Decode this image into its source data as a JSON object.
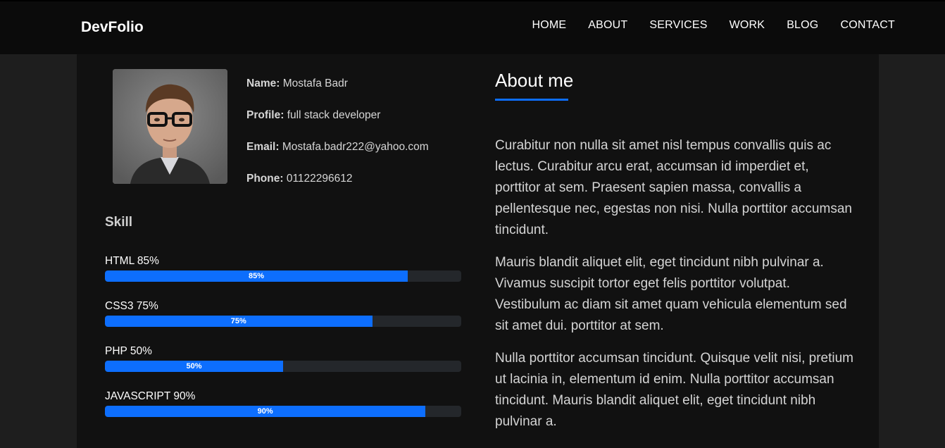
{
  "header": {
    "brand": "DevFolio",
    "nav": [
      "HOME",
      "ABOUT",
      "SERVICES",
      "WORK",
      "BLOG",
      "CONTACT"
    ]
  },
  "profile": {
    "name_label": "Name:",
    "name": "Mostafa Badr",
    "profile_label": "Profile:",
    "profile": "full stack developer",
    "email_label": "Email:",
    "email": "Mostafa.badr222@yahoo.com",
    "phone_label": "Phone:",
    "phone": "01122296612"
  },
  "skills": {
    "title": "Skill",
    "items": [
      {
        "label": "HTML 85%",
        "percent": 85,
        "bar_text": "85%"
      },
      {
        "label": "CSS3 75%",
        "percent": 75,
        "bar_text": "75%"
      },
      {
        "label": "PHP 50%",
        "percent": 50,
        "bar_text": "50%"
      },
      {
        "label": "JAVASCRIPT 90%",
        "percent": 90,
        "bar_text": "90%"
      }
    ]
  },
  "about": {
    "title": "About me",
    "paragraphs": [
      "Curabitur non nulla sit amet nisl tempus convallis quis ac lectus. Curabitur arcu erat, accumsan id imperdiet et, porttitor at sem. Praesent sapien massa, convallis a pellentesque nec, egestas non nisi. Nulla porttitor accumsan tincidunt.",
      "Mauris blandit aliquet elit, eget tincidunt nibh pulvinar a. Vivamus suscipit tortor eget felis porttitor volutpat. Vestibulum ac diam sit amet quam vehicula elementum sed sit amet dui. porttitor at sem.",
      "Nulla porttitor accumsan tincidunt. Quisque velit nisi, pretium ut lacinia in, elementum id enim. Nulla porttitor accumsan tincidunt. Mauris blandit aliquet elit, eget tincidunt nibh pulvinar a."
    ]
  },
  "colors": {
    "accent": "#0d6efd",
    "navbar_bg": "#0b0b0b",
    "card_bg": "#111111",
    "page_bg": "#1e1e1e"
  }
}
